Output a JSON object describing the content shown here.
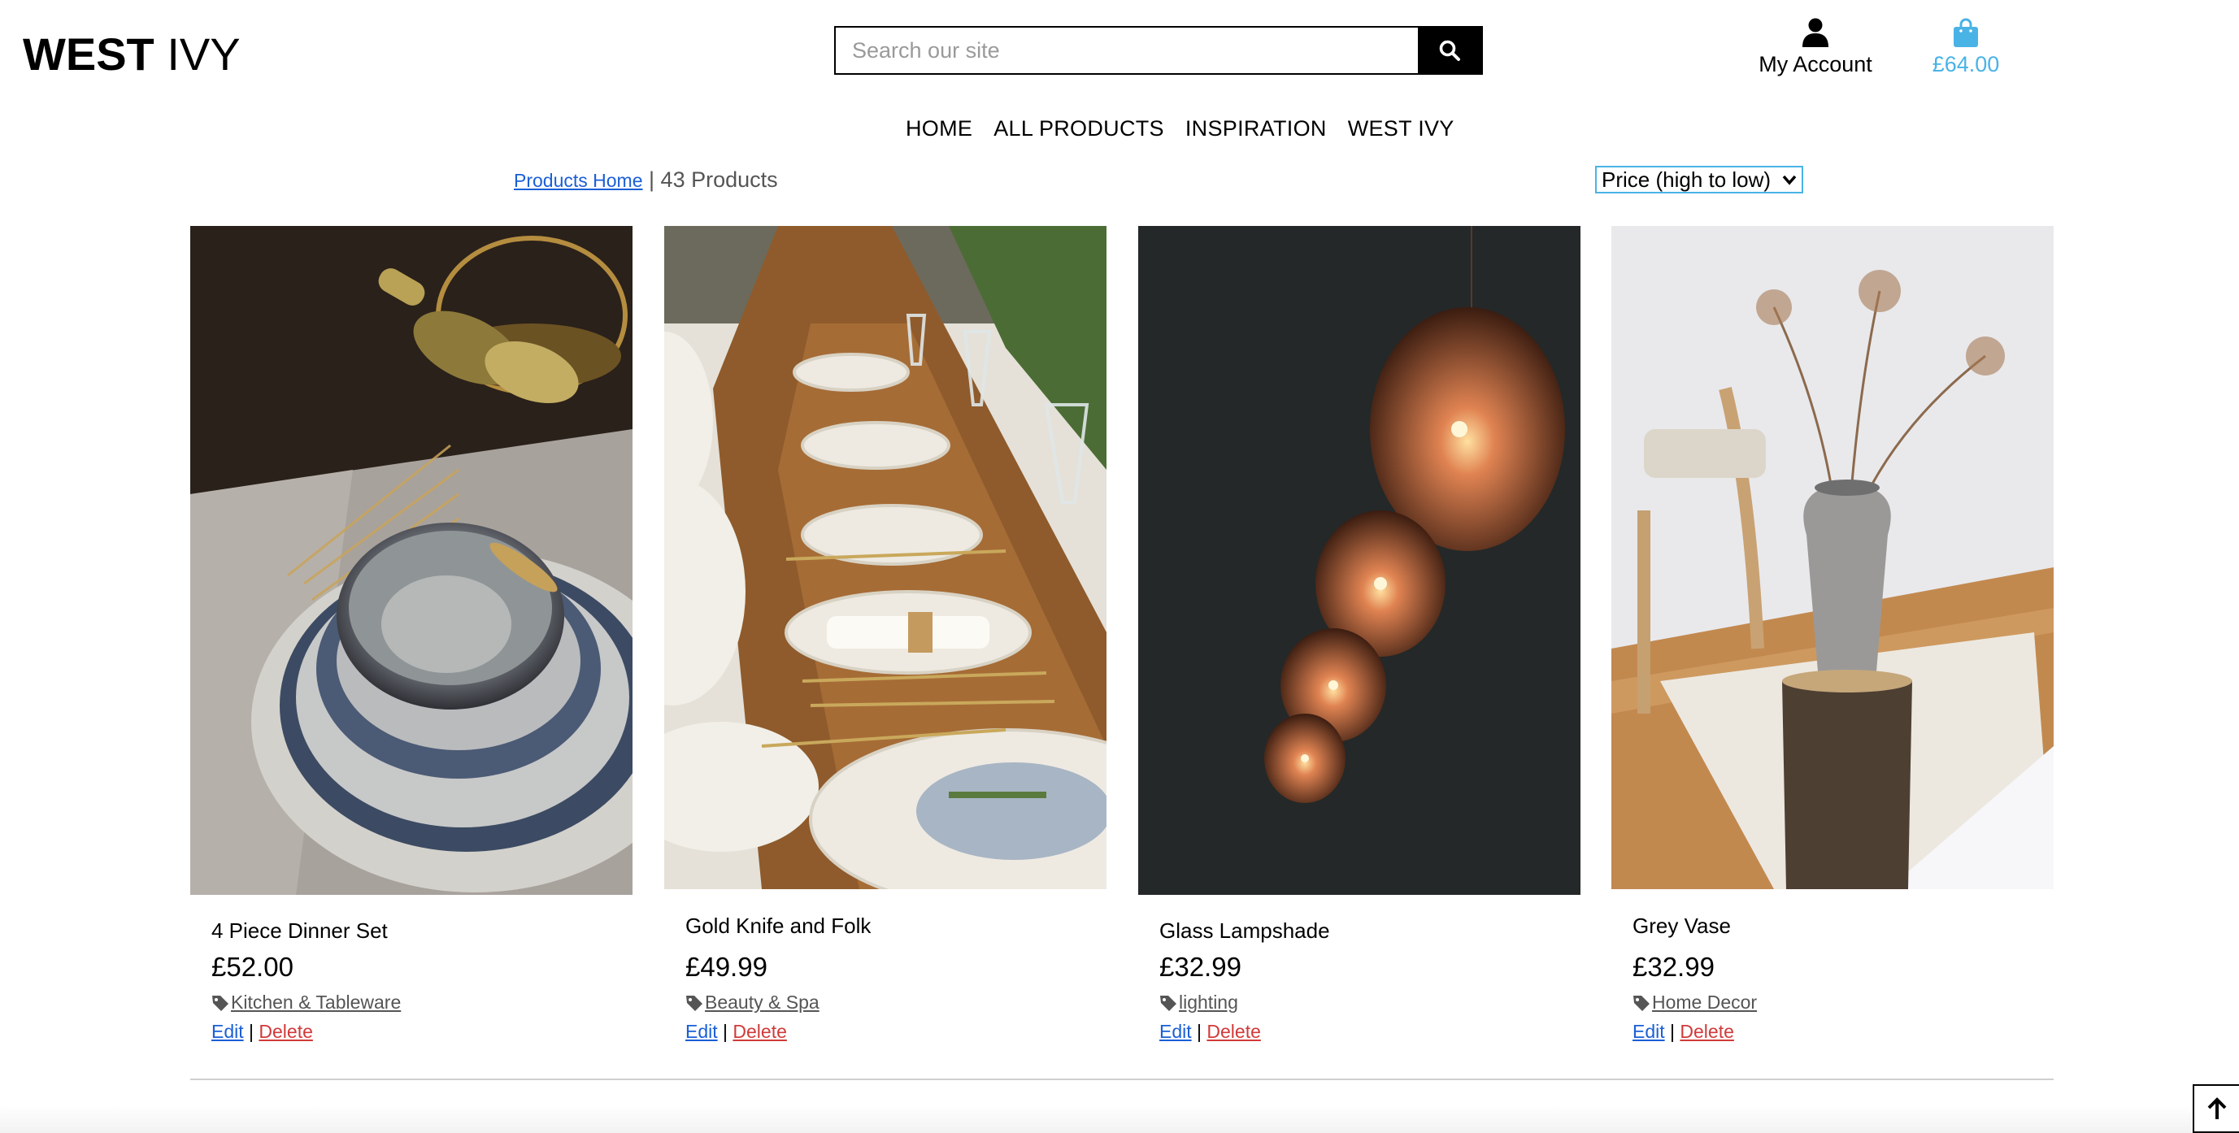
{
  "header": {
    "logo_bold": "WEST",
    "logo_light": " IVY",
    "search_placeholder": "Search our site",
    "account_label": "My Account",
    "cart_total": "£64.00"
  },
  "nav": [
    "HOME",
    "ALL PRODUCTS",
    "INSPIRATION",
    "WEST IVY"
  ],
  "toolbar": {
    "breadcrumb_link": "Products Home",
    "separator": " | ",
    "product_count": "43 Products",
    "sort_selected": "Price (high to low)"
  },
  "products": [
    {
      "name": "4 Piece Dinner Set",
      "price": "£52.00",
      "category": "Kitchen & Tableware",
      "edit": "Edit",
      "delete": "Delete"
    },
    {
      "name": "Gold Knife and Folk",
      "price": "£49.99",
      "category": "Beauty & Spa",
      "edit": "Edit",
      "delete": "Delete"
    },
    {
      "name": "Glass Lampshade",
      "price": "£32.99",
      "category": "lighting",
      "edit": "Edit",
      "delete": "Delete"
    },
    {
      "name": "Grey Vase",
      "price": "£32.99",
      "category": "Home Decor",
      "edit": "Edit",
      "delete": "Delete"
    }
  ],
  "icons": {
    "search": "search-icon",
    "account": "user-icon",
    "cart": "shopping-bag-icon",
    "tag": "tag-icon",
    "back_to_top": "arrow-up-icon"
  },
  "colors": {
    "accent": "#4ab3e6",
    "link": "#1a5fd6",
    "delete": "#d13a3a"
  }
}
